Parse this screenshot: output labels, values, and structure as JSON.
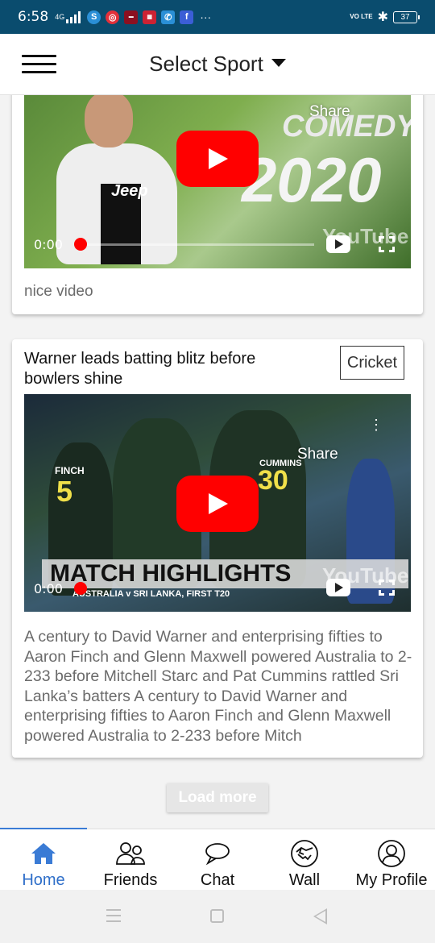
{
  "status_bar": {
    "time": "6:58",
    "network": "4G",
    "more": "···",
    "volte": "VO LTE",
    "battery": "37",
    "app_icons": [
      "skype-icon",
      "messenger-icon",
      "news-icon",
      "browser-icon",
      "phone-icon",
      "facebook-icon"
    ]
  },
  "header": {
    "title": "Select Sport",
    "menu_icon": "hamburger-icon",
    "dropdown_icon": "caret-down-icon"
  },
  "posts": [
    {
      "caption": "nice video",
      "video": {
        "share_label": "Share",
        "time": "0:00",
        "thumbnail_text_1": "COMEDY",
        "thumbnail_text_2": "2020",
        "thumbnail_jersey": "Jeep",
        "watermark": "YouTube"
      }
    },
    {
      "title": "Warner leads batting blitz before bowlers shine",
      "sport": "Cricket",
      "video": {
        "share_label": "Share",
        "time": "0:00",
        "banner": "MATCH HIGHLIGHTS",
        "sub_banner": "AUSTRALIA v SRI LANKA, FIRST T20",
        "watermark": "YouTube",
        "jersey_name": "FINCH",
        "jersey_number": "5",
        "jersey_number_2": "30",
        "jersey_name_2": "CUMMINS"
      },
      "description": "A century to David Warner and enterprising fifties to Aaron Finch and Glenn Maxwell powered Australia to 2-233 before Mitchell Starc and Pat Cummins rattled Sri Lanka’s batters A century to David Warner and enterprising fifties to Aaron Finch and Glenn Maxwell powered Australia to 2-233 before Mitch"
    }
  ],
  "load_more_label": "Load more",
  "bottom_nav": [
    {
      "label": "Home",
      "icon": "home-icon",
      "active": true
    },
    {
      "label": "Friends",
      "icon": "friends-icon",
      "active": false
    },
    {
      "label": "Chat",
      "icon": "chat-icon",
      "active": false
    },
    {
      "label": "Wall",
      "icon": "handshake-icon",
      "active": false
    },
    {
      "label": "My Profile",
      "icon": "profile-icon",
      "active": false
    }
  ],
  "colors": {
    "status_bar": "#0a4c6e",
    "accent": "#2f6fc9",
    "youtube_red": "#ff0000"
  }
}
